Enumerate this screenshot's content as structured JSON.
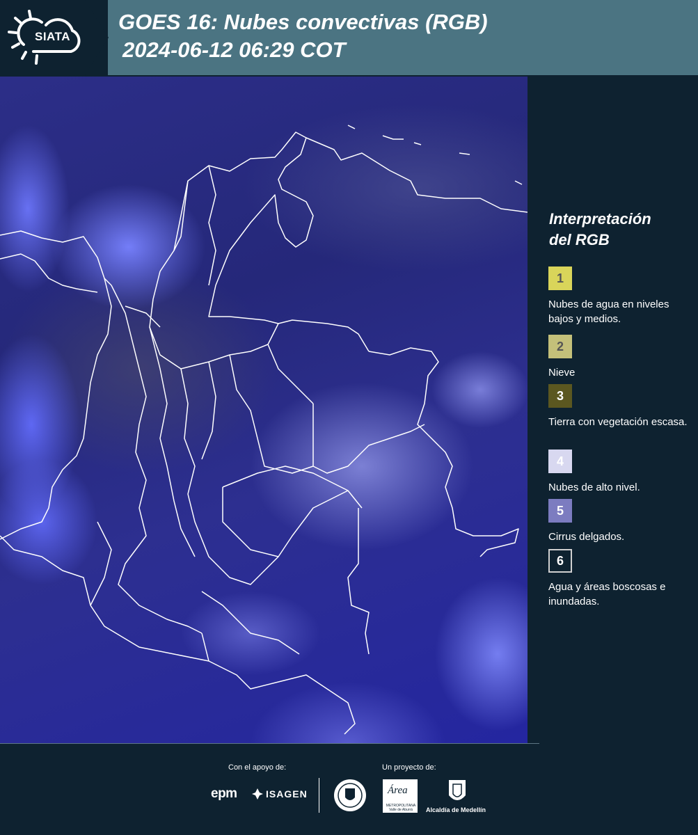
{
  "header": {
    "logo_text": "SIATA",
    "title_line1": "GOES 16: Nubes convectivas (RGB)",
    "title_line2": "2024-06-12 06:29 COT",
    "background_color": "#4b7482",
    "logo_background_color": "#0e2230"
  },
  "legend": {
    "title_line1": "Interpretación",
    "title_line2": "del RGB",
    "items": [
      {
        "number": "1",
        "label": "Nubes de agua en niveles bajos y medios.",
        "color": "#d9d55a",
        "number_color": "#555555"
      },
      {
        "number": "2",
        "label": "Nieve",
        "color": "#c4c07a",
        "number_color": "#555555"
      },
      {
        "number": "3",
        "label": "Tierra con vegetación escasa.",
        "color": "#5b5720",
        "number_color": "#ffffff"
      },
      {
        "number": "4",
        "label": "Nubes de alto nivel.",
        "color": "#d8d8f0",
        "number_color": "#ffffff"
      },
      {
        "number": "5",
        "label": "Cirrus delgados.",
        "color": "#7c7cc0",
        "number_color": "#ffffff"
      },
      {
        "number": "6",
        "label": "Agua y áreas boscosas e inundadas.",
        "color": "#0e2230",
        "number_color": "#ffffff"
      }
    ]
  },
  "map": {
    "description_icon": "satellite-rgb-image",
    "border_color": "#ffffff"
  },
  "footer": {
    "support_label": "Con el apoyo de:",
    "project_label": "Un proyecto de:",
    "sponsors": [
      "epm",
      "ISAGEN"
    ],
    "partners": {
      "area_title": "Área",
      "area_subtitle": "METROPOLITANA Valle de Aburrá",
      "alcaldia": "Alcaldía de Medellín"
    }
  }
}
